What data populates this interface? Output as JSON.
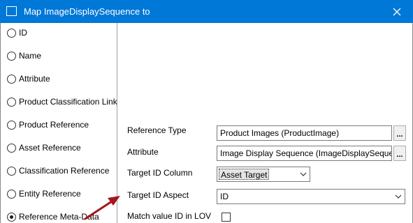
{
  "window": {
    "title": "Map ImageDisplaySequence to"
  },
  "map_options": [
    {
      "label": "ID",
      "checked": false
    },
    {
      "label": "Name",
      "checked": false
    },
    {
      "label": "Attribute",
      "checked": false
    },
    {
      "label": "Product Classification Link",
      "checked": false
    },
    {
      "label": "Product Reference",
      "checked": false
    },
    {
      "label": "Asset Reference",
      "checked": false
    },
    {
      "label": "Classification Reference",
      "checked": false
    },
    {
      "label": "Entity Reference",
      "checked": false
    },
    {
      "label": "Reference Meta-Data",
      "checked": true
    }
  ],
  "form": {
    "reference_type": {
      "label": "Reference Type",
      "value": "Product Images (ProductImage)"
    },
    "attribute": {
      "label": "Attribute",
      "value": "Image Display Sequence (ImageDisplaySequence)"
    },
    "target_id_column": {
      "label": "Target ID Column",
      "value": "Asset Target"
    },
    "target_id_aspect": {
      "label": "Target ID Aspect",
      "value": "ID"
    },
    "match_value_id": {
      "label": "Match value ID in LOV",
      "checked": false
    }
  },
  "buttons": {
    "browse_label": "..."
  },
  "colors": {
    "titlebar": "#0078d7",
    "arrow": "#a4161a"
  }
}
